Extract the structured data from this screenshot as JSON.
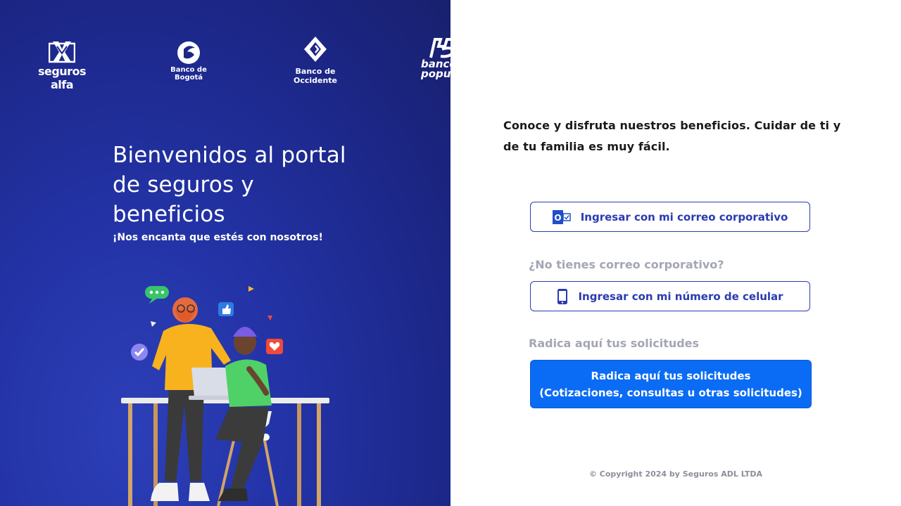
{
  "logos": {
    "alfa": "seguros alfa",
    "bogota_line1": "Banco de",
    "bogota_line2": "Bogotá",
    "occidente_line1": "Banco de",
    "occidente_line2": "Occidente",
    "popular_line1": "banco",
    "popular_line2": "popular"
  },
  "welcome": {
    "title": "Bienvenidos al portal de seguros y beneficios",
    "subtitle": "¡Nos encanta que estés con nosotros!"
  },
  "intro": "Conoce y disfruta nuestros beneficios. Cuidar de ti y de tu familia es muy fácil.",
  "buttons": {
    "corporate_email": "Ingresar con mi correo corporativo",
    "no_email_label": "¿No tienes correo corporativo?",
    "phone": "Ingresar con mi número de celular",
    "requests_label": "Radica aquí tus solicitudes",
    "requests_line1": "Radica aquí tus solicitudes",
    "requests_line2": "(Cotizaciones, consultas u otras solicitudes)"
  },
  "footer": "© Copyright 2024 by Seguros ADL LTDA",
  "colors": {
    "left_bg": "#1c2788",
    "primary": "#0a6cf5",
    "outline": "#2a3bb0",
    "muted": "#a3a6b4"
  }
}
